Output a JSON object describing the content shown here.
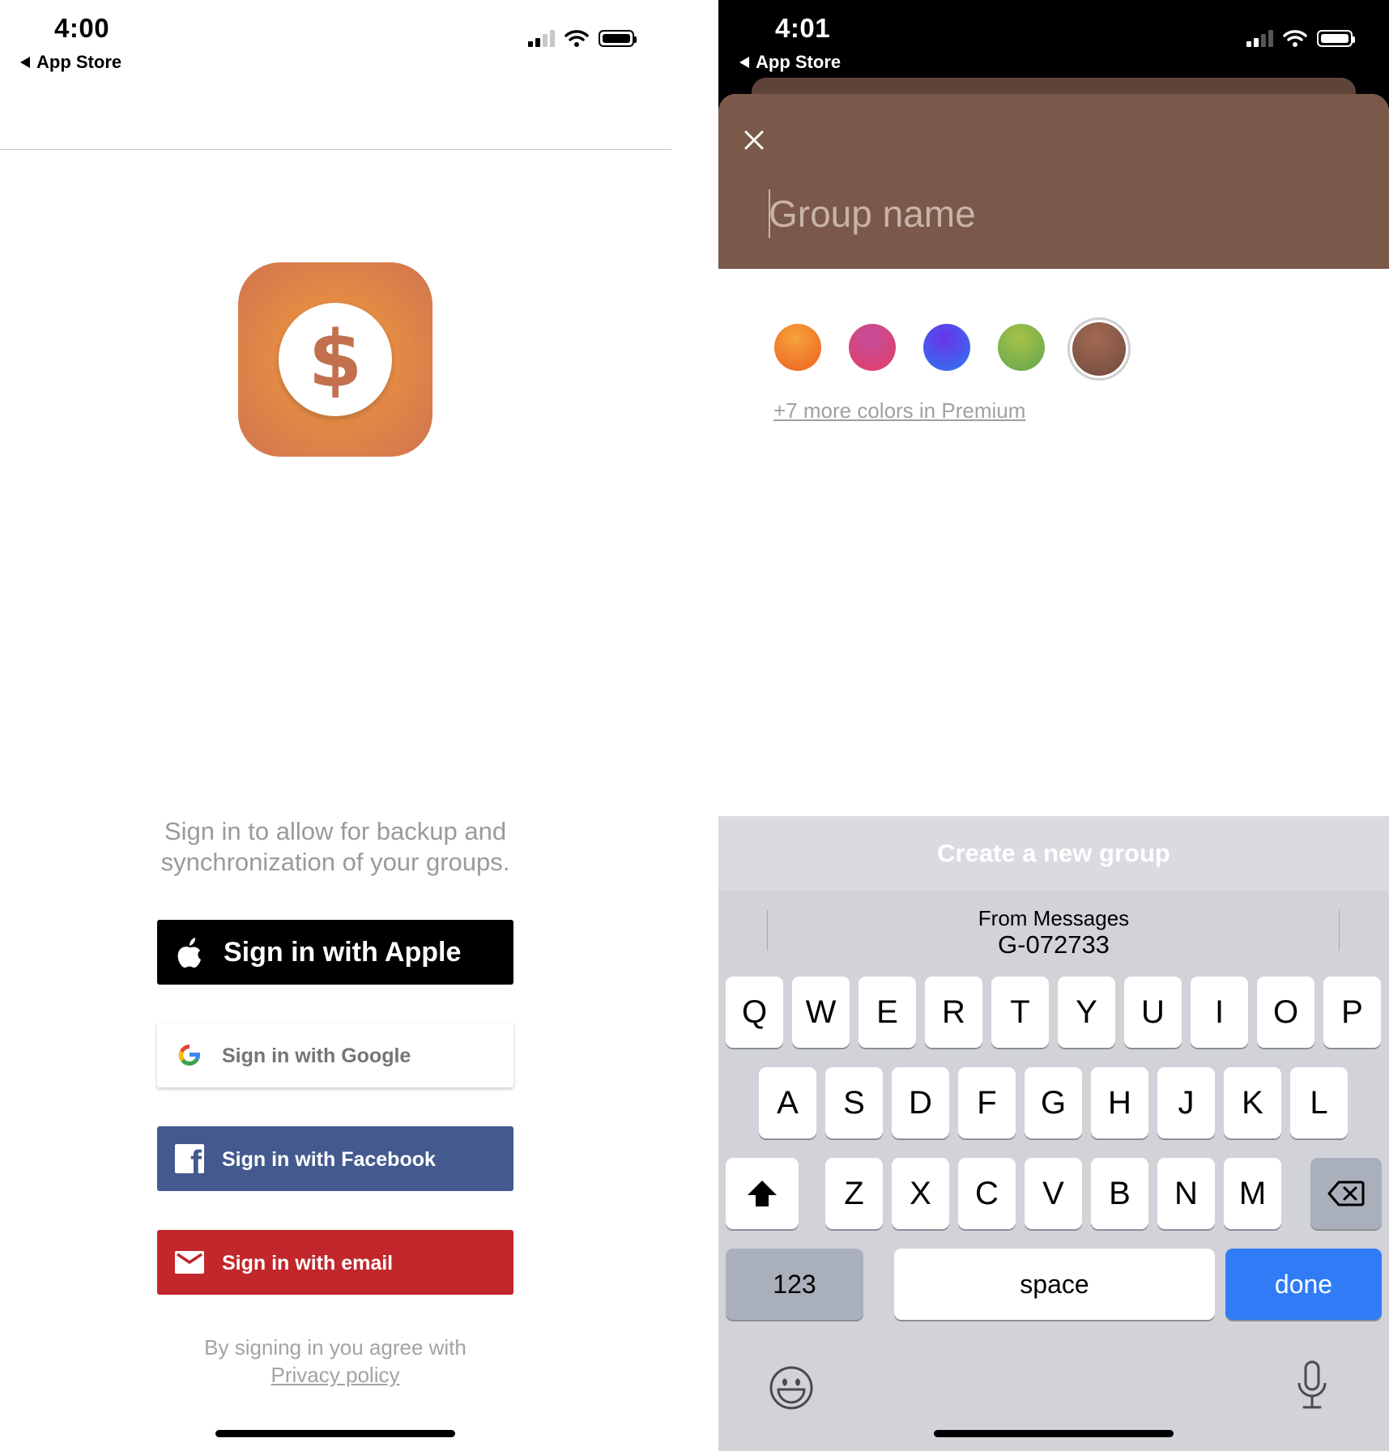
{
  "left_screen": {
    "status_bar": {
      "time": "4:00",
      "back_label": "App Store"
    },
    "description": "Sign in to allow for backup and synchronization of your groups.",
    "buttons": {
      "apple": "Sign in with Apple",
      "google": "Sign in with Google",
      "facebook": "Sign in with Facebook",
      "email": "Sign in with email"
    },
    "terms_text": "By signing in you agree with",
    "privacy_link": "Privacy policy",
    "app_icon": "dollar-sign-icon"
  },
  "right_screen": {
    "status_bar": {
      "time": "4:01",
      "back_label": "App Store"
    },
    "group_name_placeholder": "Group name",
    "colors": [
      "#f07a2b",
      "#d2467a",
      "#4f5bf0",
      "#86b24c",
      "#8a5a48"
    ],
    "selected_color_index": 4,
    "premium_link": "+7 more colors in Premium",
    "create_button": "Create a new group",
    "suggestion": {
      "title": "From Messages",
      "value": "G-072733"
    },
    "keyboard": {
      "row1": [
        "Q",
        "W",
        "E",
        "R",
        "T",
        "Y",
        "U",
        "I",
        "O",
        "P"
      ],
      "row2": [
        "A",
        "S",
        "D",
        "F",
        "G",
        "H",
        "J",
        "K",
        "L"
      ],
      "row3": [
        "Z",
        "X",
        "C",
        "V",
        "B",
        "N",
        "M"
      ],
      "numbers_key": "123",
      "space_key": "space",
      "done_key": "done"
    }
  },
  "colors": {
    "apple": "#000000",
    "google": "#ffffff",
    "facebook": "#445a8e",
    "email": "#c1272b",
    "header_brown": "#7a584a",
    "done_blue": "#2f7cf6"
  }
}
